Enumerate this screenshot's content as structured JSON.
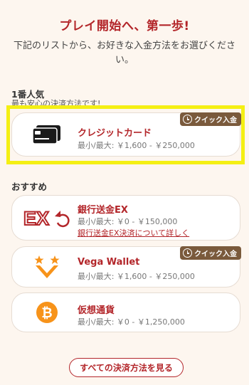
{
  "header": {
    "title": "プレイ開始へ、第一歩!",
    "subtitle": "下記のリストから、お好きな入金方法をお選びください。"
  },
  "popular": {
    "heading": "1番人気",
    "subheading": "最も安心の決済方法です!",
    "card": {
      "name": "クレジットカード",
      "range": "最小/最大: ￥1,600 - ￥250,000",
      "badge": "クイック入金"
    }
  },
  "recommended": {
    "heading": "おすすめ",
    "cards": [
      {
        "name": "銀行送金EX",
        "range": "最小/最大: ￥0 - ￥150,000",
        "link": "銀行送金EX決済について詳しく",
        "logo_text": "EX"
      },
      {
        "name": "Vega Wallet",
        "range": "最小/最大: ￥1,600 - ￥250,000",
        "badge": "クイック入金"
      },
      {
        "name": "仮想通貨",
        "range": "最小/最大: ￥0 - ￥1,250,000",
        "logo_text": "₿"
      }
    ]
  },
  "all_methods_button": "すべての決済方法を見る",
  "colors": {
    "brand_red": "#b3262a",
    "badge_brown": "#7a5a3c",
    "highlight_yellow": "#f4ef13",
    "bitcoin_orange": "#f7931a"
  }
}
